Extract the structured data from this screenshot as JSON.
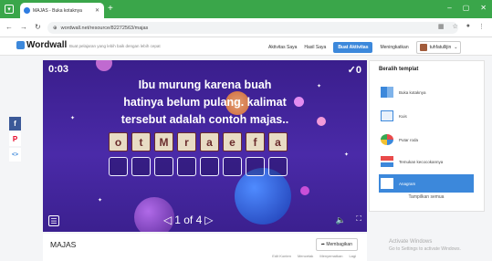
{
  "browser": {
    "tab_title": "MAJAS - Buka kotaknya",
    "url": "wordwall.net/resource/82272563/majas",
    "new_tab": "+",
    "window_controls": [
      "–",
      "▢",
      "✕"
    ]
  },
  "header": {
    "logo": "Wordwall",
    "tagline": "Buat pelajaran yang lebih baik dengan lebih cepat",
    "nav": [
      "Aktivitas Saya",
      "Hasil Saya"
    ],
    "create_button": "Buat Aktivitas",
    "upgrade": "Meningkatkan",
    "user": "tuhfatullijin"
  },
  "game": {
    "timer": "0:03",
    "score": "✓0",
    "question_lines": [
      "Ibu murung karena buah",
      "hatinya belum pulang. kalimat",
      "tersebut adalah contoh majas.."
    ],
    "letters": [
      "o",
      "t",
      "M",
      "r",
      "a",
      "e",
      "f",
      "a"
    ],
    "slot_count": 8,
    "pager": {
      "current": 1,
      "total": 4,
      "text": "1 of 4"
    },
    "colors": {
      "background": "#4a2aa8",
      "tile": "#e8dcc4",
      "tile_border": "#6a2c2c"
    }
  },
  "share_sidebar": [
    {
      "icon": "facebook-icon",
      "glyph": "f",
      "color": "#3b5998"
    },
    {
      "icon": "pinterest-icon",
      "glyph": "P",
      "color": "#e60023"
    },
    {
      "icon": "embed-icon",
      "glyph": "<>",
      "color": "#3c88db"
    }
  ],
  "templates": {
    "title": "Beralih templat",
    "items": [
      {
        "label": "Buka kotaknya",
        "icon": "open-box-icon",
        "active": false
      },
      {
        "label": "Kuis",
        "icon": "quiz-icon",
        "active": false
      },
      {
        "label": "Putar roda",
        "icon": "spin-wheel-icon",
        "active": false
      },
      {
        "label": "Temukan kecocokannya",
        "icon": "find-match-icon",
        "active": false
      },
      {
        "label": "Anagram",
        "icon": "anagram-icon",
        "active": true
      }
    ],
    "more_label": "Tampilkan semua"
  },
  "activity": {
    "title": "MAJAS",
    "share_label": "Membagikan",
    "links": [
      "Edit Konten",
      "Mencetak",
      "Menyematkan",
      "Lagi"
    ]
  },
  "watermark": {
    "line1": "Activate Windows",
    "line2": "Go to Settings to activate Windows."
  }
}
